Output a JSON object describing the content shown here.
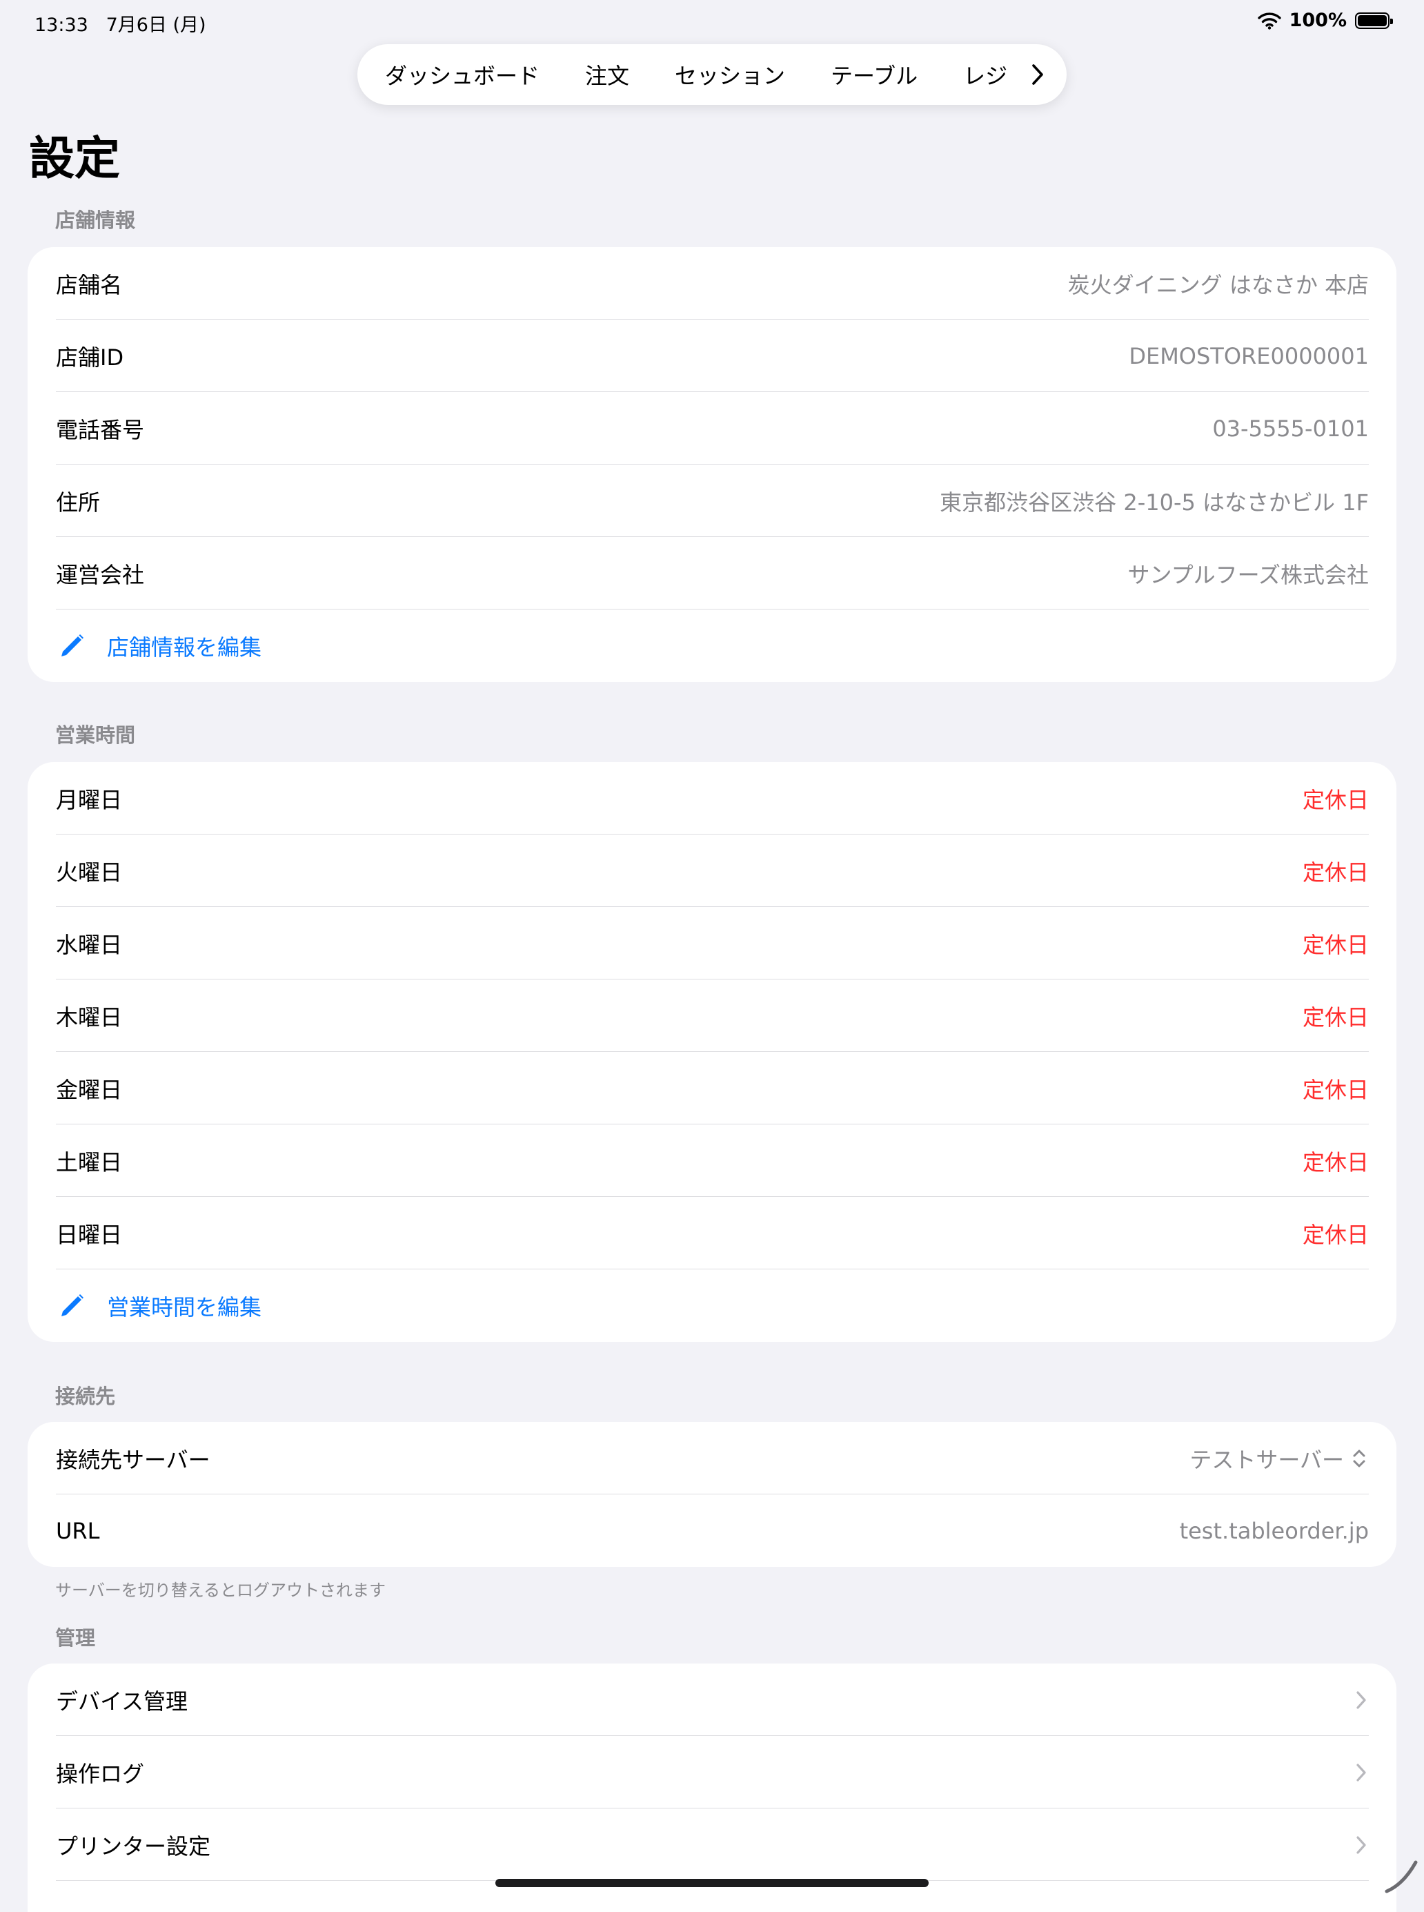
{
  "status_bar": {
    "time": "13:33",
    "date": "7月6日 (月)",
    "battery": "100%"
  },
  "tabs": [
    "ダッシュボード",
    "注文",
    "セッション",
    "テーブル",
    "レジ"
  ],
  "page_title": "設定",
  "store_info": {
    "header": "店舗情報",
    "rows": [
      {
        "label": "店舗名",
        "value": "炭火ダイニング はなさか 本店"
      },
      {
        "label": "店舗ID",
        "value": "DEMOSTORE0000001"
      },
      {
        "label": "電話番号",
        "value": "03-5555-0101"
      },
      {
        "label": "住所",
        "value": "東京都渋谷区渋谷 2-10-5 はなさかビル 1F"
      },
      {
        "label": "運営会社",
        "value": "サンプルフーズ株式会社"
      }
    ],
    "edit_label": "店舗情報を編集"
  },
  "hours": {
    "header": "営業時間",
    "rows": [
      {
        "label": "月曜日",
        "value": "定休日"
      },
      {
        "label": "火曜日",
        "value": "定休日"
      },
      {
        "label": "水曜日",
        "value": "定休日"
      },
      {
        "label": "木曜日",
        "value": "定休日"
      },
      {
        "label": "金曜日",
        "value": "定休日"
      },
      {
        "label": "土曜日",
        "value": "定休日"
      },
      {
        "label": "日曜日",
        "value": "定休日"
      }
    ],
    "edit_label": "営業時間を編集"
  },
  "connection": {
    "header": "接続先",
    "server_label": "接続先サーバー",
    "server_value": "テストサーバー",
    "url_label": "URL",
    "url_value": "test.tableorder.jp",
    "footnote": "サーバーを切り替えるとログアウトされます"
  },
  "management": {
    "header": "管理",
    "rows": [
      {
        "label": "デバイス管理"
      },
      {
        "label": "操作ログ"
      },
      {
        "label": "プリンター設定"
      }
    ]
  },
  "colors": {
    "accent": "#0a7aff",
    "closed": "#ff2d2d",
    "secondary": "#8a8a8e",
    "background": "#f2f2f7"
  }
}
